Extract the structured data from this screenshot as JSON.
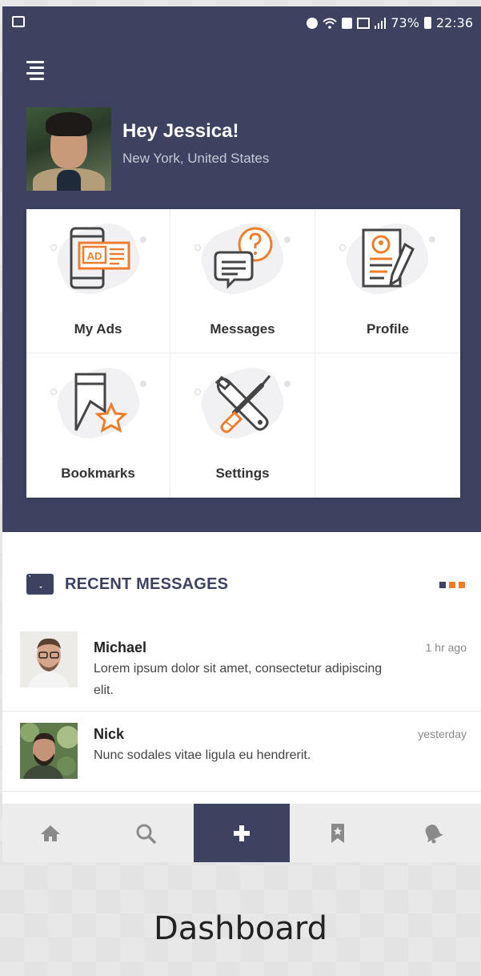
{
  "status_bar": {
    "battery": "73%",
    "time": "22:36"
  },
  "user": {
    "greeting": "Hey Jessica!",
    "location": "New York, United States"
  },
  "menu_tiles": [
    {
      "label": "My Ads",
      "icon": "ad-phone-icon"
    },
    {
      "label": "Messages",
      "icon": "chat-question-icon"
    },
    {
      "label": "Profile",
      "icon": "profile-document-icon"
    },
    {
      "label": "Bookmarks",
      "icon": "bookmark-star-icon"
    },
    {
      "label": "Settings",
      "icon": "wrench-screwdriver-icon"
    }
  ],
  "ad_icon_text": "AD",
  "recent_messages": {
    "title": "RECENT MESSAGES",
    "items": [
      {
        "name": "Michael",
        "text": "Lorem ipsum dolor sit amet, consectetur adipiscing elit.",
        "time": "1 hr ago"
      },
      {
        "name": "Nick",
        "text": "Nunc sodales vitae ligula eu hendrerit.",
        "time": "yesterday"
      }
    ]
  },
  "tabbar": [
    {
      "icon": "home-icon"
    },
    {
      "icon": "search-icon"
    },
    {
      "icon": "plus-icon",
      "active": true
    },
    {
      "icon": "bookmark-icon"
    },
    {
      "icon": "bell-icon"
    }
  ],
  "colors": {
    "primary": "#3c4260",
    "accent": "#f07d2b"
  },
  "caption": "Dashboard"
}
